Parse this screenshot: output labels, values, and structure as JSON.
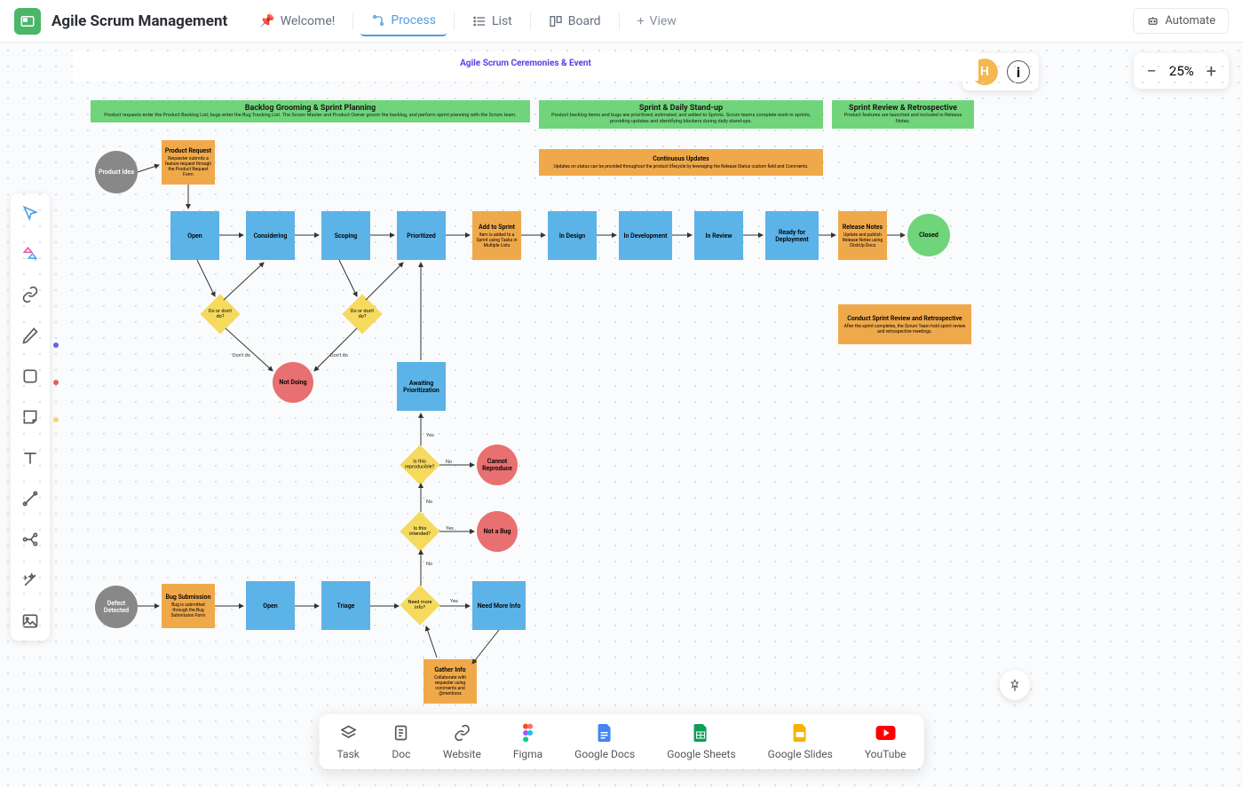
{
  "header": {
    "title": "Agile Scrum Management",
    "tabs": [
      {
        "label": "Welcome!",
        "icon": "pin"
      },
      {
        "label": "Process",
        "icon": "flow",
        "active": true
      },
      {
        "label": "List",
        "icon": "list"
      },
      {
        "label": "Board",
        "icon": "board"
      }
    ],
    "add_view": "View",
    "automate": "Automate"
  },
  "user": {
    "initial": "H"
  },
  "zoom": {
    "level": "25%"
  },
  "diagram_title": "Agile Scrum Ceremonies & Event",
  "lanes": [
    {
      "title": "Backlog Grooming & Sprint Planning",
      "sub": "Product requests enter the Product Backlog List; bugs enter the Bug Tracking List. The Scrum Master and Product Owner groom the backlog, and perform sprint planning with the Scrum team."
    },
    {
      "title": "Sprint & Daily Stand-up",
      "sub": "Product backlog items and bugs are prioritized, estimated, and added to Sprints. Scrum teams complete work in sprints, providing updates and identifying blockers during daily stand-ups."
    },
    {
      "title": "Sprint Review & Retrospective",
      "sub": "Product features are launched and included in Release Notes."
    }
  ],
  "continuous": {
    "title": "Continuous Updates",
    "sub": "Updates on status can be provided throughout the product lifecycle by leveraging the Release Status custom field and Comments."
  },
  "nodes": {
    "product_idea": "Product Idea",
    "product_request": {
      "t": "Product Request",
      "s": "Requester submits a feature request through the Product Request Form"
    },
    "open": "Open",
    "considering": "Considering",
    "scoping": "Scoping",
    "prioritized": "Prioritized",
    "add_to_sprint": {
      "t": "Add to Sprint",
      "s": "Item is added to a Sprint using Tasks in Multiple Lists"
    },
    "in_design": "In Design",
    "in_development": "In Development",
    "in_review": "In Review",
    "ready_deploy": "Ready for Deployment",
    "release_notes": {
      "t": "Release Notes",
      "s": "Update and publish Release Notes using ClickUp Docs"
    },
    "closed": "Closed",
    "do_dont1": "Do or don't do?",
    "do_dont2": "Do or don't do?",
    "not_doing": "Not Doing",
    "awaiting": "Awaiting Prioritization",
    "reproducible": "Is this reproducible?",
    "cannot_repro": "Cannot Reproduce",
    "intended": "Is this intended?",
    "not_bug": "Not a Bug",
    "defect": "Defect Detected",
    "bug_sub": {
      "t": "Bug Submission",
      "s": "Bug is submitted through the Bug Submission Form"
    },
    "open2": "Open",
    "triage": "Triage",
    "need_more": "Need more info?",
    "need_more_box": "Need More Info",
    "gather": {
      "t": "Gather Info",
      "s": "Collaborate with requester using comments and @mentions"
    },
    "retro": {
      "t": "Conduct Sprint Review and Retrospective",
      "s": "After the sprint completes, the Scrum Team hold sprint review and retrospective meetings."
    }
  },
  "labels": {
    "dontdo1": "Don't do",
    "dontdo2": "Don't do",
    "yes": "Yes",
    "no": "No"
  },
  "dock": [
    {
      "label": "Task",
      "icon": "task"
    },
    {
      "label": "Doc",
      "icon": "doc"
    },
    {
      "label": "Website",
      "icon": "link"
    },
    {
      "label": "Figma",
      "icon": "figma"
    },
    {
      "label": "Google Docs",
      "icon": "gdocs"
    },
    {
      "label": "Google Sheets",
      "icon": "gsheets"
    },
    {
      "label": "Google Slides",
      "icon": "gslides"
    },
    {
      "label": "YouTube",
      "icon": "youtube"
    }
  ]
}
